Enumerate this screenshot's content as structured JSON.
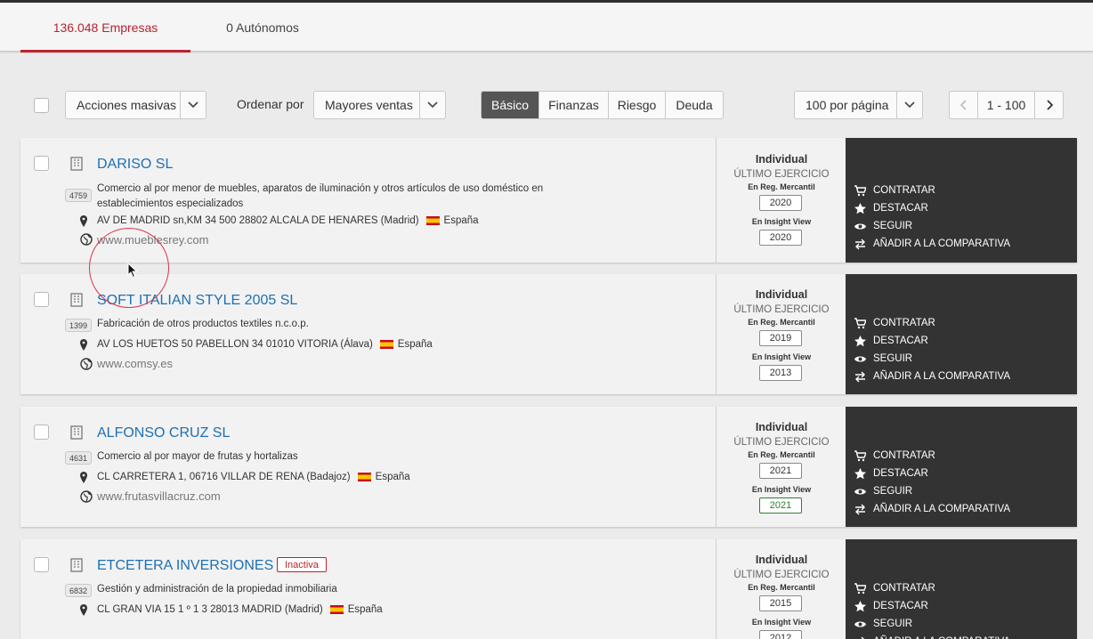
{
  "tabs": [
    {
      "label": "136.048 Empresas",
      "active": true
    },
    {
      "label": "0 Autónomos",
      "active": false
    }
  ],
  "toolbar": {
    "bulk_actions": "Acciones masivas",
    "sort_label": "Ordenar por",
    "sort_value": "Mayores ventas",
    "views": [
      "Básico",
      "Finanzas",
      "Riesgo",
      "Deuda"
    ],
    "active_view": "Básico",
    "per_page": "100 por página",
    "range": "1 - 100"
  },
  "actions": {
    "buy": "CONTRATAR",
    "highlight": "DESTACAR",
    "follow": "SEGUIR",
    "compare": "AÑADIR A LA COMPARATIVA"
  },
  "labels": {
    "type": "Individual",
    "last_exercise": "ÚLTIMO EJERCICIO",
    "reg_mercantil": "En Reg. Mercantil",
    "insight_view": "En Insight View",
    "country": "España"
  },
  "companies": [
    {
      "name": "DARISO SL",
      "cnae": "4759",
      "description": "Comercio al por menor de muebles, aparatos de iluminación y otros artículos de uso doméstico en establecimientos especializados",
      "address": "AV DE MADRID sn,KM 34 500  28802  ALCALA DE HENARES  (Madrid)",
      "website": "www.mueblesrey.com",
      "year_reg": "2020",
      "year_insight": "2020"
    },
    {
      "name": "SOFT ITALIAN STYLE 2005 SL",
      "cnae": "1399",
      "description": "Fabricación de otros productos textiles n.c.o.p.",
      "address": "AV LOS HUETOS 50 PABELLON 34  01010  VITORIA  (Álava)",
      "website": "www.comsy.es",
      "year_reg": "2019",
      "year_insight": "2013"
    },
    {
      "name": "ALFONSO CRUZ SL",
      "cnae": "4631",
      "description": "Comercio al por mayor de frutas y hortalizas",
      "address": "CL CARRETERA 1,  06716  VILLAR DE RENA  (Badajoz)",
      "website": "www.frutasvillacruz.com",
      "year_reg": "2021",
      "year_insight": "2021"
    },
    {
      "name": "ETCETERA INVERSIONES SL",
      "status": "Inactiva",
      "cnae": "6832",
      "description": "Gestión y administración de la propiedad inmobiliaria",
      "address": "CL GRAN VIA 15 1 º 1 3  28013  MADRID  (Madrid)",
      "year_reg": "2015",
      "year_insight": "2012"
    }
  ]
}
